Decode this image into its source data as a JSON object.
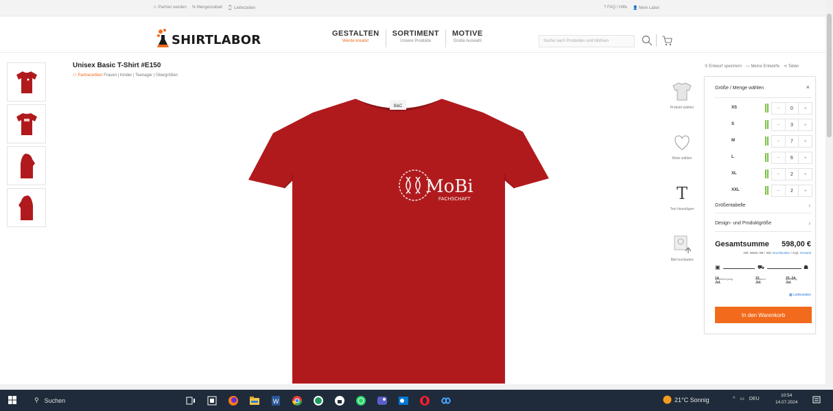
{
  "utility": {
    "left": [
      "Partner werden",
      "Mengenrabatt",
      "Lieferzeiten"
    ],
    "right": [
      "FAQ / Hilfe",
      "Mein Labor"
    ]
  },
  "header": {
    "logo": "SHIRTLABOR",
    "nav": [
      {
        "title": "GESTALTEN",
        "subtitle": "Werde kreativ!"
      },
      {
        "title": "SORTIMENT",
        "subtitle": "Unsere Produkte"
      },
      {
        "title": "MOTIVE",
        "subtitle": "Große Auswahl"
      }
    ],
    "search_placeholder": "Suche nach Produkten und Motiven"
  },
  "product": {
    "title": "Unisex Basic T-Shirt #E150",
    "partner_label": "Partnerartikel",
    "categories": "Frauen | Kinder | Teenager | Übergrößen",
    "shirt_color": "#b11a1d",
    "print_text": "MoBi",
    "print_subtext": "FACHSCHAFT",
    "neck_label": "B&C"
  },
  "tools": [
    {
      "icon": "tshirt-icon",
      "label": "Produkt wählen"
    },
    {
      "icon": "heart-icon",
      "label": "Motiv wählen"
    },
    {
      "icon": "text-icon",
      "label": "Text hinzufügen"
    },
    {
      "icon": "image-upload-icon",
      "label": "Bild hochladen"
    }
  ],
  "actions": [
    "Entwurf speichern",
    "Meine Entwürfe",
    "Teilen"
  ],
  "panel": {
    "heading": "Größe / Menge wählen",
    "close": "×",
    "sizes": [
      {
        "size": "XS",
        "qty": "0"
      },
      {
        "size": "S",
        "qty": "3"
      },
      {
        "size": "M",
        "qty": "7"
      },
      {
        "size": "L",
        "qty": "6"
      },
      {
        "size": "XL",
        "qty": "2"
      },
      {
        "size": "XXL",
        "qty": "2"
      }
    ],
    "minus": "−",
    "plus": "+",
    "size_table": "Größentabelle",
    "design_size": "Design- und Produktgröße",
    "total_label": "Gesamtsumme",
    "total_amount": "598,00 €",
    "tax_prefix": "Inkl. MwSt. DE / Inkl.",
    "tax_print": "Druckkosten",
    "tax_mid": "/ zzgl.",
    "tax_shipping": "Versand",
    "dates": [
      {
        "date": "14. Jul.",
        "caption": "Bestelleingang"
      },
      {
        "date": "22. Jul.",
        "caption": "Versand"
      },
      {
        "date": "23.-24. Jul.",
        "caption": "Lieferung"
      }
    ],
    "calendar_link": "Lieferzeiten",
    "cta": "In den Warenkorb"
  },
  "taskbar": {
    "search": "Suchen",
    "weather": "21°C Sonnig",
    "lang": "DEU",
    "time": "10:54",
    "date": "14.07.2024"
  },
  "colors": {
    "accent": "#f26a1b",
    "shirt": "#b11a1d",
    "stock": "#7bc043",
    "link": "#2a7ad8",
    "taskbar": "#1f2b3a"
  }
}
